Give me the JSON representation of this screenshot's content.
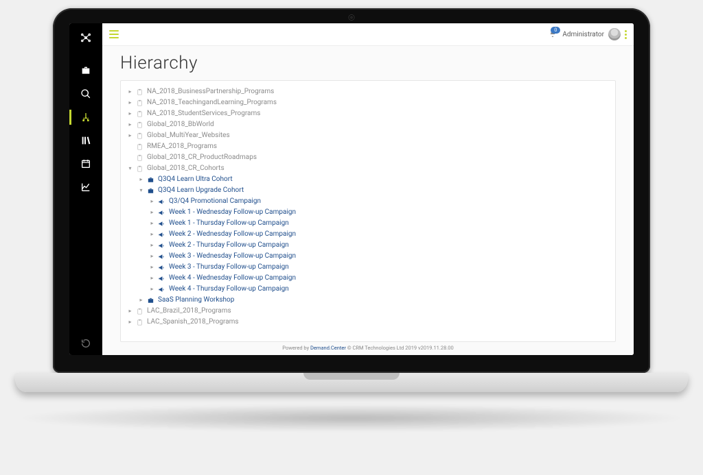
{
  "header": {
    "notification_count": "0",
    "user_label": "Administrator"
  },
  "page": {
    "title": "Hierarchy"
  },
  "sidebar": {
    "items": [
      {
        "name": "briefcase",
        "active": false
      },
      {
        "name": "search",
        "active": false
      },
      {
        "name": "hierarchy",
        "active": true
      },
      {
        "name": "library",
        "active": false
      },
      {
        "name": "calendar",
        "active": false
      },
      {
        "name": "analytics",
        "active": false
      }
    ]
  },
  "tree": [
    {
      "lvl": 0,
      "caret": "right",
      "icon": "clip",
      "style": "gray",
      "label": "NA_2018_BusinessPartnership_Programs"
    },
    {
      "lvl": 0,
      "caret": "right",
      "icon": "clip",
      "style": "gray",
      "label": "NA_2018_TeachingandLearning_Programs"
    },
    {
      "lvl": 0,
      "caret": "right",
      "icon": "clip",
      "style": "gray",
      "label": "NA_2018_StudentServices_Programs"
    },
    {
      "lvl": 0,
      "caret": "right",
      "icon": "clip",
      "style": "gray",
      "label": "Global_2018_BbWorld"
    },
    {
      "lvl": 0,
      "caret": "right",
      "icon": "clip",
      "style": "gray",
      "label": "Global_MultiYear_Websites"
    },
    {
      "lvl": 0,
      "caret": "none",
      "icon": "clip",
      "style": "gray",
      "label": "RMEA_2018_Programs"
    },
    {
      "lvl": 0,
      "caret": "none",
      "icon": "clip",
      "style": "gray",
      "label": "Global_2018_CR_ProductRoadmaps"
    },
    {
      "lvl": 0,
      "caret": "down",
      "icon": "clip",
      "style": "gray",
      "label": "Global_2018_CR_Cohorts"
    },
    {
      "lvl": 1,
      "caret": "right",
      "icon": "case",
      "style": "link",
      "label": "Q3Q4 Learn Ultra Cohort"
    },
    {
      "lvl": 1,
      "caret": "down",
      "icon": "case",
      "style": "link",
      "label": "Q3Q4 Learn Upgrade Cohort"
    },
    {
      "lvl": 2,
      "caret": "right",
      "icon": "horn",
      "style": "link",
      "label": "Q3/Q4 Promotional Campaign"
    },
    {
      "lvl": 2,
      "caret": "right",
      "icon": "horn",
      "style": "link",
      "label": "Week 1 - Wednesday Follow-up Campaign"
    },
    {
      "lvl": 2,
      "caret": "right",
      "icon": "horn",
      "style": "link",
      "label": "Week 1 - Thursday Follow-up Campaign"
    },
    {
      "lvl": 2,
      "caret": "right",
      "icon": "horn",
      "style": "link",
      "label": "Week 2 - Wednesday Follow-up Campaign"
    },
    {
      "lvl": 2,
      "caret": "right",
      "icon": "horn",
      "style": "link",
      "label": "Week 2 - Thursday Follow-up Campaign"
    },
    {
      "lvl": 2,
      "caret": "right",
      "icon": "horn",
      "style": "link",
      "label": "Week 3 - Wednesday Follow-up Campaign"
    },
    {
      "lvl": 2,
      "caret": "right",
      "icon": "horn",
      "style": "link",
      "label": "Week 3 - Thursday Follow-up Campaign"
    },
    {
      "lvl": 2,
      "caret": "right",
      "icon": "horn",
      "style": "link",
      "label": "Week 4 - Wednesday Follow-up Campaign"
    },
    {
      "lvl": 2,
      "caret": "right",
      "icon": "horn",
      "style": "link",
      "label": "Week 4 - Thursday Follow-up Campaign"
    },
    {
      "lvl": 1,
      "caret": "right",
      "icon": "case",
      "style": "link",
      "label": "SaaS Planning Workshop"
    },
    {
      "lvl": 0,
      "caret": "right",
      "icon": "clip",
      "style": "gray",
      "label": "LAC_Brazil_2018_Programs"
    },
    {
      "lvl": 0,
      "caret": "right",
      "icon": "clip",
      "style": "gray",
      "label": "LAC_Spanish_2018_Programs"
    }
  ],
  "footer": {
    "prefix": "Powered by ",
    "link": "Demand.Center",
    "suffix": "  © CRM Technologies Ltd 2019 v2019.11.28.00"
  }
}
